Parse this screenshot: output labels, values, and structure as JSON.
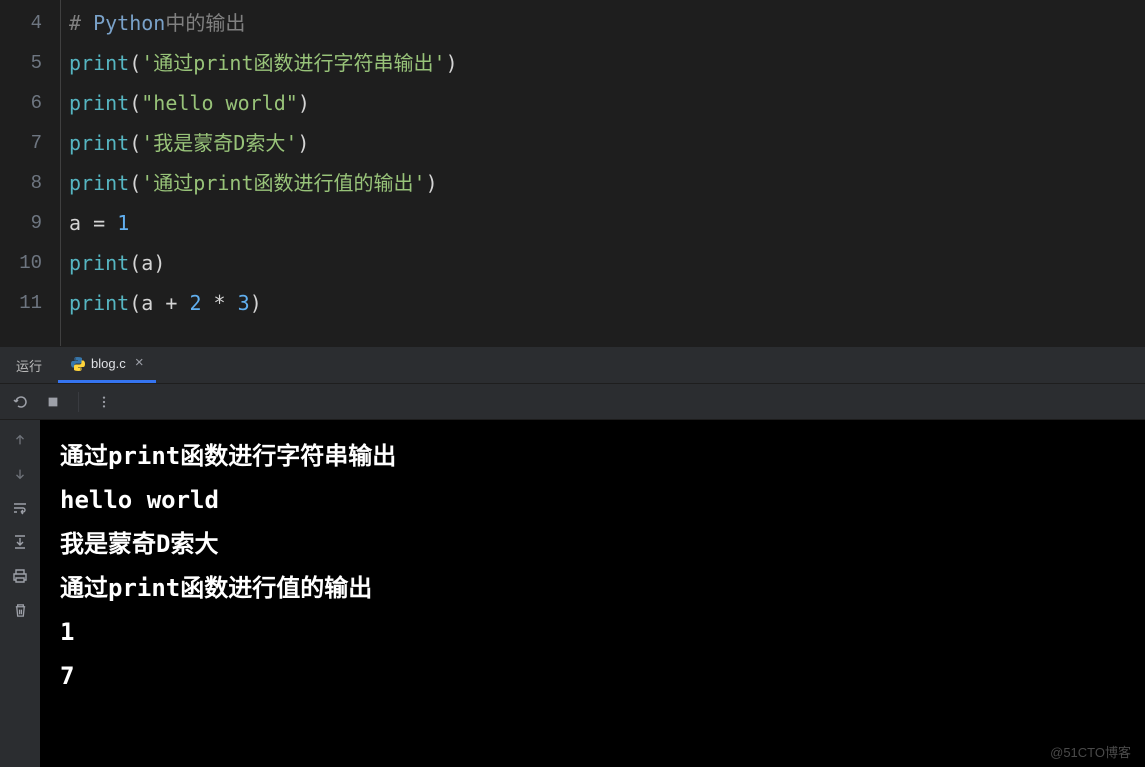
{
  "editor": {
    "line_numbers": [
      "4",
      "5",
      "6",
      "7",
      "8",
      "9",
      "10",
      "11"
    ],
    "lines": [
      {
        "comment_hash": "# ",
        "comment_en": "Python",
        "comment_cn": "中的输出"
      },
      {
        "func": "print",
        "paren_l": "(",
        "str": "'通过print函数进行字符串输出'",
        "paren_r": ")"
      },
      {
        "func": "print",
        "paren_l": "(",
        "str": "\"hello world\"",
        "paren_r": ")"
      },
      {
        "func": "print",
        "paren_l": "(",
        "str": "'我是蒙奇D索大'",
        "paren_r": ")"
      },
      {
        "func": "print",
        "paren_l": "(",
        "str": "'通过print函数进行值的输出'",
        "paren_r": ")"
      },
      {
        "var": "a",
        "sp1": " ",
        "op": "=",
        "sp2": " ",
        "num": "1"
      },
      {
        "func": "print",
        "paren_l": "(",
        "var": "a",
        "paren_r": ")"
      },
      {
        "func": "print",
        "paren_l": "(",
        "var": "a",
        "sp1": " ",
        "op1": "+",
        "sp2": " ",
        "num1": "2",
        "sp3": " ",
        "op2": "*",
        "sp4": " ",
        "num2": "3",
        "paren_r": ")"
      }
    ]
  },
  "panel": {
    "label": "运行",
    "tab_name": "blog.c",
    "tab_close": "×"
  },
  "output": {
    "lines": [
      "通过print函数进行字符串输出",
      "hello world",
      "我是蒙奇D索大",
      "通过print函数进行值的输出",
      "1",
      "7"
    ]
  },
  "watermark": "@51CTO博客"
}
